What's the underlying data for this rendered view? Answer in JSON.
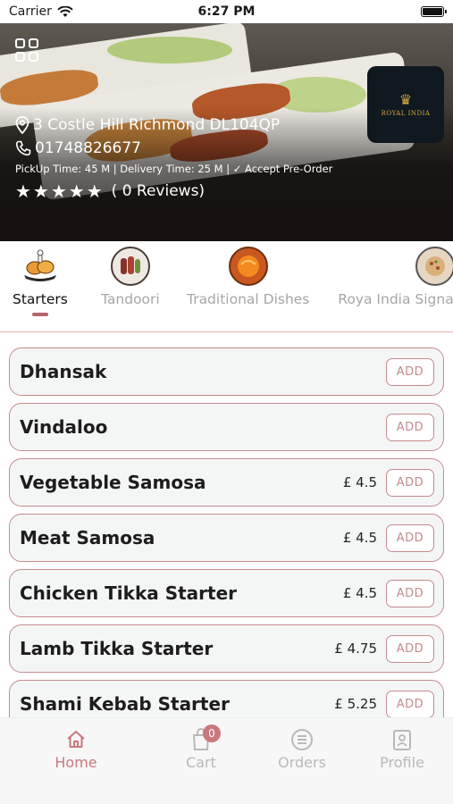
{
  "status_bar": {
    "carrier": "Carrier",
    "time": "6:27 PM"
  },
  "restaurant": {
    "logo_text": "ROYAL INDIA",
    "address": "3 Costle Hill Richmond DL104QP",
    "phone": "01748826677",
    "times": "PickUp Time: 45 M | Delivery Time: 25 M | ✓ Accept Pre-Order",
    "rating_stars": 5,
    "stars": "★★★★★",
    "reviews": "( 0 Reviews)"
  },
  "categories": [
    {
      "label": "Starters",
      "icon": "chicken-leg-icon",
      "active": true
    },
    {
      "label": "Tandoori",
      "icon": "tandoori-plate-icon",
      "active": false
    },
    {
      "label": "Traditional Dishes",
      "icon": "curry-bowl-icon",
      "active": false
    },
    {
      "label": "Roya India Signa",
      "icon": "signature-dish-icon",
      "active": false
    }
  ],
  "menu_items": [
    {
      "name": "Dhansak",
      "price": "",
      "add_label": "ADD"
    },
    {
      "name": "Vindaloo",
      "price": "",
      "add_label": "ADD"
    },
    {
      "name": "Vegetable Samosa",
      "price": "£ 4.5",
      "add_label": "ADD"
    },
    {
      "name": "Meat Samosa",
      "price": "£ 4.5",
      "add_label": "ADD"
    },
    {
      "name": "Chicken Tikka Starter",
      "price": "£ 4.5",
      "add_label": "ADD"
    },
    {
      "name": "Lamb Tikka Starter",
      "price": "£ 4.75",
      "add_label": "ADD"
    },
    {
      "name": "Shami Kebab Starter",
      "price": "£ 5.25",
      "add_label": "ADD"
    }
  ],
  "tabbar": {
    "tabs": [
      {
        "label": "Home",
        "icon": "home-icon",
        "active": true
      },
      {
        "label": "Cart",
        "icon": "cart-bag-icon",
        "active": false,
        "badge": "0"
      },
      {
        "label": "Orders",
        "icon": "orders-list-icon",
        "active": false
      },
      {
        "label": "Profile",
        "icon": "profile-badge-icon",
        "active": false
      }
    ]
  },
  "colors": {
    "accent": "#c9787c",
    "card_border": "#c58a8e",
    "card_bg": "#f4f6f6",
    "inactive": "#b8b8b8"
  }
}
